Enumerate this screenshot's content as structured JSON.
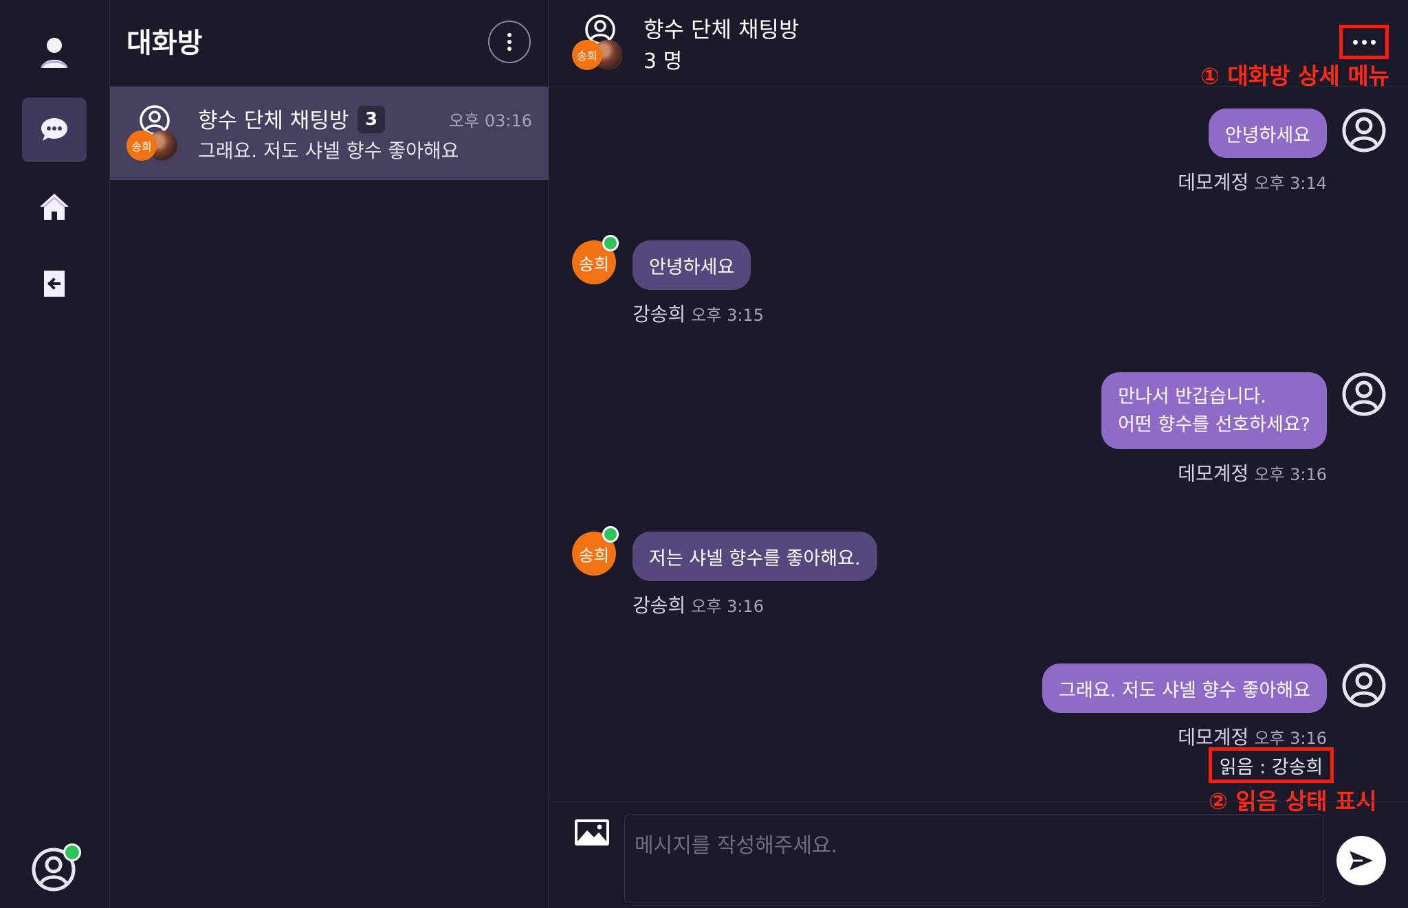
{
  "nav": {
    "items": [
      {
        "icon": "user-icon"
      },
      {
        "icon": "chat-bubble-icon",
        "active": true
      },
      {
        "icon": "home-icon"
      },
      {
        "icon": "logout-icon"
      }
    ],
    "online_color": "#2ec45a"
  },
  "room_list": {
    "title": "대화방",
    "rooms": [
      {
        "name": "향수 단체 채팅방",
        "member_count": "3",
        "time": "오후 03:16",
        "last_message": "그래요. 저도 샤넬 향수 좋아해요",
        "avatar_initials": "송희"
      }
    ]
  },
  "chat": {
    "title": "향수 단체 채팅방",
    "members": "3 명",
    "header_avatar_initials": "송희",
    "annotations": {
      "menu": "① 대화방 상세 메뉴",
      "read": "② 읽음 상태 표시"
    },
    "messages": [
      {
        "from": "me",
        "lines": [
          "안녕하세요"
        ],
        "sender": "데모계정",
        "time": "오후 3:14"
      },
      {
        "from": "them",
        "lines": [
          "안녕하세요"
        ],
        "sender": "강송희",
        "time": "오후 3:15",
        "initials": "송희"
      },
      {
        "from": "me",
        "lines": [
          "만나서 반갑습니다.",
          "어떤 향수를 선호하세요?"
        ],
        "sender": "데모계정",
        "time": "오후 3:16"
      },
      {
        "from": "them",
        "lines": [
          "저는 샤넬 향수를 좋아해요."
        ],
        "sender": "강송희",
        "time": "오후 3:16",
        "initials": "송희"
      },
      {
        "from": "me",
        "lines": [
          "그래요. 저도 샤넬 향수 좋아해요"
        ],
        "sender": "데모계정",
        "time": "오후 3:16"
      }
    ],
    "read_status": "읽음 : 강송희",
    "composer": {
      "placeholder": "메시지를 작성해주세요.",
      "value": ""
    }
  },
  "colors": {
    "background": "#1b1a2b",
    "selected_room": "#46405e",
    "my_bubble": "#8f6ac6",
    "their_bubble": "#56487c",
    "partner_avatar": "#f27314",
    "annotation": "#ff2a14"
  }
}
